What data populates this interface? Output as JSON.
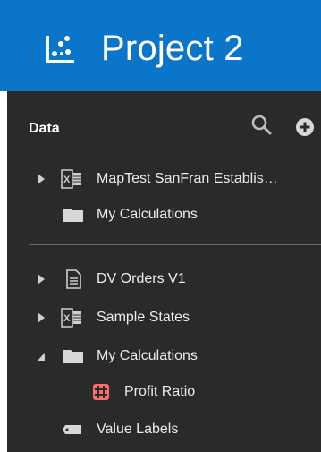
{
  "header": {
    "title": "Project 2",
    "logo_icon": "scatter-plot-icon",
    "background": "#0a75c9"
  },
  "panel": {
    "title": "Data",
    "background": "#2a2a2a",
    "actions": [
      {
        "icon": "search-icon"
      },
      {
        "icon": "add-circle-icon"
      }
    ],
    "top_items": [
      {
        "label": "MapTest SanFran Establis…",
        "icon": "excel-icon",
        "expandable": true,
        "expanded": false
      },
      {
        "label": "My Calculations",
        "icon": "folder-icon",
        "expandable": false
      }
    ],
    "bottom_items": [
      {
        "label": "DV Orders V1",
        "icon": "document-icon",
        "expandable": true,
        "expanded": false
      },
      {
        "label": "Sample States",
        "icon": "excel-icon",
        "expandable": true,
        "expanded": false
      },
      {
        "label": "My Calculations",
        "icon": "folder-icon",
        "expandable": true,
        "expanded": true
      },
      {
        "label": "Profit Ratio",
        "icon": "calculation-icon",
        "accent": "#ff6b6b"
      },
      {
        "label": "Value Labels",
        "icon": "tag-icon",
        "expandable": false
      }
    ]
  }
}
